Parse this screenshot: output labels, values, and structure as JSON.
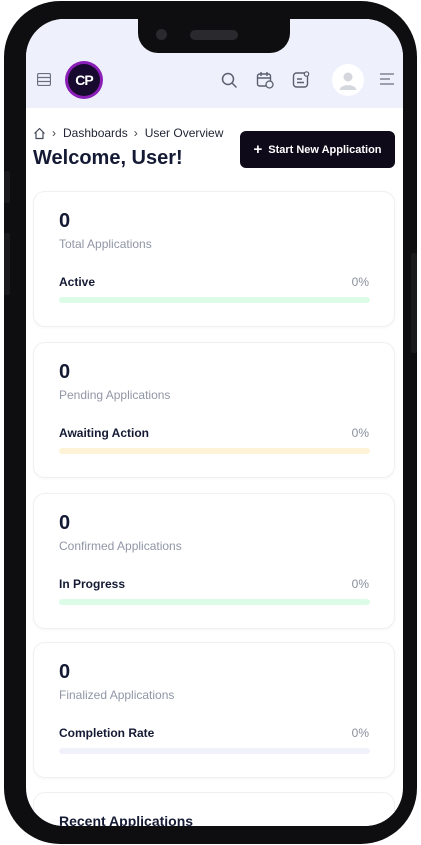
{
  "header": {
    "logo_text": "CP",
    "icons": [
      "menu-icon",
      "search-icon",
      "calendar-icon",
      "notes-icon",
      "avatar-icon",
      "align-icon"
    ]
  },
  "breadcrumb": {
    "home": "home-icon",
    "items": [
      "Dashboards",
      "User Overview"
    ]
  },
  "page": {
    "title": "Welcome, User!",
    "cta_label": "Start New Application"
  },
  "cards": [
    {
      "count": "0",
      "label": "Total Applications",
      "sub_label": "Active",
      "percent_text": "0%",
      "progress": 0,
      "track_color": "#dcfce7",
      "fill_color": "#22c55e"
    },
    {
      "count": "0",
      "label": "Pending Applications",
      "sub_label": "Awaiting Action",
      "percent_text": "0%",
      "progress": 0,
      "track_color": "#fef3d6",
      "fill_color": "#f59e0b"
    },
    {
      "count": "0",
      "label": "Confirmed Applications",
      "sub_label": "In Progress",
      "percent_text": "0%",
      "progress": 0,
      "track_color": "#dcfce7",
      "fill_color": "#22c55e"
    },
    {
      "count": "0",
      "label": "Finalized Applications",
      "sub_label": "Completion Rate",
      "percent_text": "0%",
      "progress": 0,
      "track_color": "#f1f1fb",
      "fill_color": "#8b5cf6"
    }
  ],
  "recent": {
    "title": "Recent Applications"
  }
}
